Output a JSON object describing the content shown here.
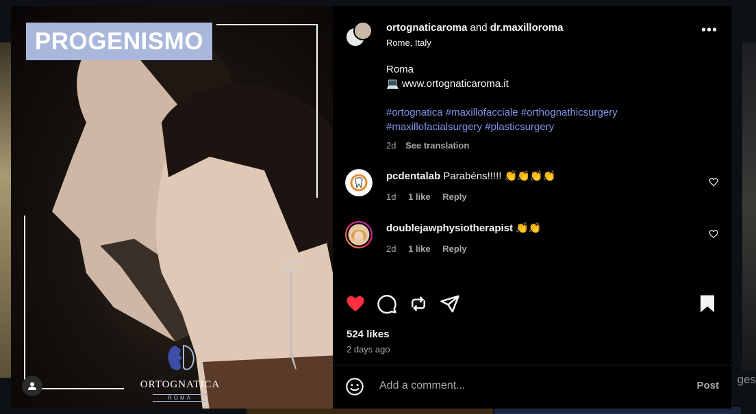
{
  "post": {
    "title_overlay": "PROGENISMO",
    "logo_name": "ORTOGNATICA",
    "logo_sub": "ROMA"
  },
  "header": {
    "user1": "ortognaticaroma",
    "and": "and",
    "user2": "dr.maxilloroma",
    "location": "Rome, Italy",
    "more_label": "•••"
  },
  "caption": {
    "line1": "Roma",
    "line2": "💻 www.ortognaticaroma.it",
    "hashtags1": "#ortognatica #maxillofacciale #orthognathicsurgery",
    "hashtags2": "#maxillofacialsurgery #plasticsurgery",
    "time": "2d",
    "translate": "See translation"
  },
  "comments": [
    {
      "user": "pcdentalab",
      "text": "Parabéns!!!!! 👏👏👏👏",
      "time": "1d",
      "likes": "1 like",
      "reply": "Reply"
    },
    {
      "user": "doublejawphysiotherapist",
      "text": "👏👏",
      "time": "2d",
      "likes": "1 like",
      "reply": "Reply"
    }
  ],
  "stats": {
    "likes": "524 likes",
    "ago": "2 days ago"
  },
  "composer": {
    "placeholder": "Add a comment...",
    "post_label": "Post"
  },
  "background": {
    "partial_text": "ges"
  },
  "icons": {
    "like": "heart-filled-icon",
    "comment": "comment-icon",
    "repost": "repost-icon",
    "share": "send-icon",
    "save": "bookmark-filled-icon",
    "emoji": "emoji-icon",
    "tag": "user-tag-icon"
  },
  "colors": {
    "heart": "#ff3040",
    "hashtag": "#7f94e8",
    "title_box": "#a9b7dc"
  }
}
